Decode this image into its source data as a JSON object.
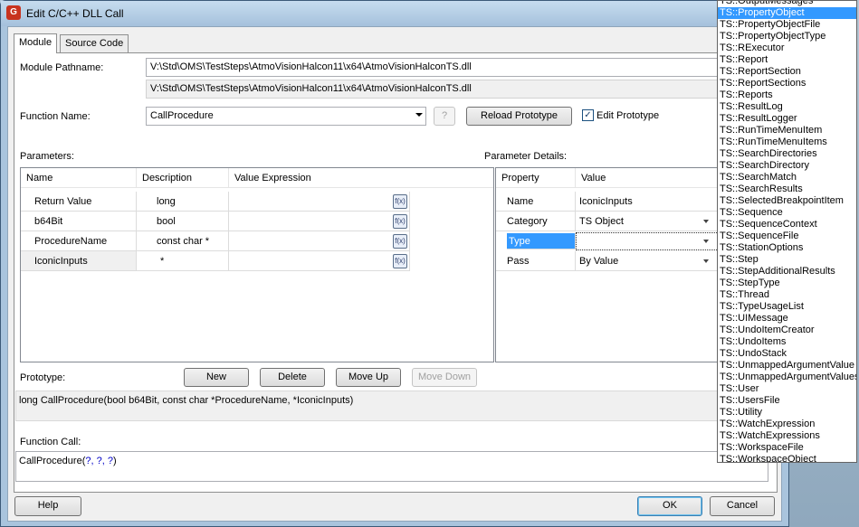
{
  "window": {
    "title": "Edit C/C++ DLL Call",
    "icon": "teststand-app-icon"
  },
  "tabs": [
    {
      "label": "Module"
    },
    {
      "label": "Source Code"
    }
  ],
  "module": {
    "pathname_label": "Module Pathname:",
    "pathname_value": "V:\\Std\\OMS\\TestSteps\\AtmoVisionHalcon11\\x64\\AtmoVisionHalconTS.dll",
    "pathname_resolved": "V:\\Std\\OMS\\TestSteps\\AtmoVisionHalcon11\\x64\\AtmoVisionHalconTS.dll",
    "function_label": "Function Name:",
    "function_value": "CallProcedure",
    "help_q": "?",
    "reload_label": "Reload Prototype",
    "edit_prototype_label": "Edit Prototype",
    "edit_prototype_checked": true
  },
  "parameters": {
    "label": "Parameters:",
    "columns": [
      "Name",
      "Description",
      "Value Expression"
    ],
    "rows": [
      {
        "name": "Return Value",
        "description": "long",
        "value": ""
      },
      {
        "name": "b64Bit",
        "description": "bool",
        "value": ""
      },
      {
        "name": "ProcedureName",
        "description": "const char *",
        "value": ""
      },
      {
        "name": "IconicInputs",
        "description": "*",
        "value": ""
      }
    ],
    "buttons": {
      "new": "New",
      "delete": "Delete",
      "move_up": "Move Up",
      "move_down": "Move Down"
    }
  },
  "details": {
    "label": "Parameter Details:",
    "columns": [
      "Property",
      "Value"
    ],
    "rows": [
      {
        "property": "Name",
        "value": "IconicInputs"
      },
      {
        "property": "Category",
        "value": "TS Object"
      },
      {
        "property": "Type",
        "value": ""
      },
      {
        "property": "Pass",
        "value": "By Value"
      }
    ]
  },
  "prototype": {
    "label": "Prototype:",
    "text": "long CallProcedure(bool b64Bit, const char *ProcedureName,  *IconicInputs)"
  },
  "function_call": {
    "label": "Function Call:",
    "name": "CallProcedure(",
    "args": "?, ?, ?",
    "close": ")"
  },
  "footer": {
    "help": "Help",
    "ok": "OK",
    "cancel": "Cancel"
  },
  "type_dropdown": {
    "selected": "TS::PropertyObject",
    "items": [
      "TS::OutputMessages",
      "TS::PropertyObject",
      "TS::PropertyObjectFile",
      "TS::PropertyObjectType",
      "TS::RExecutor",
      "TS::Report",
      "TS::ReportSection",
      "TS::ReportSections",
      "TS::Reports",
      "TS::ResultLog",
      "TS::ResultLogger",
      "TS::RunTimeMenuItem",
      "TS::RunTimeMenuItems",
      "TS::SearchDirectories",
      "TS::SearchDirectory",
      "TS::SearchMatch",
      "TS::SearchResults",
      "TS::SelectedBreakpointItem",
      "TS::Sequence",
      "TS::SequenceContext",
      "TS::SequenceFile",
      "TS::StationOptions",
      "TS::Step",
      "TS::StepAdditionalResults",
      "TS::StepType",
      "TS::Thread",
      "TS::TypeUsageList",
      "TS::UIMessage",
      "TS::UndoItemCreator",
      "TS::UndoItems",
      "TS::UndoStack",
      "TS::UnmappedArgumentValue",
      "TS::UnmappedArgumentValues",
      "TS::User",
      "TS::UsersFile",
      "TS::Utility",
      "TS::WatchExpression",
      "TS::WatchExpressions",
      "TS::WorkspaceFile",
      "TS::WorkspaceObject"
    ]
  }
}
